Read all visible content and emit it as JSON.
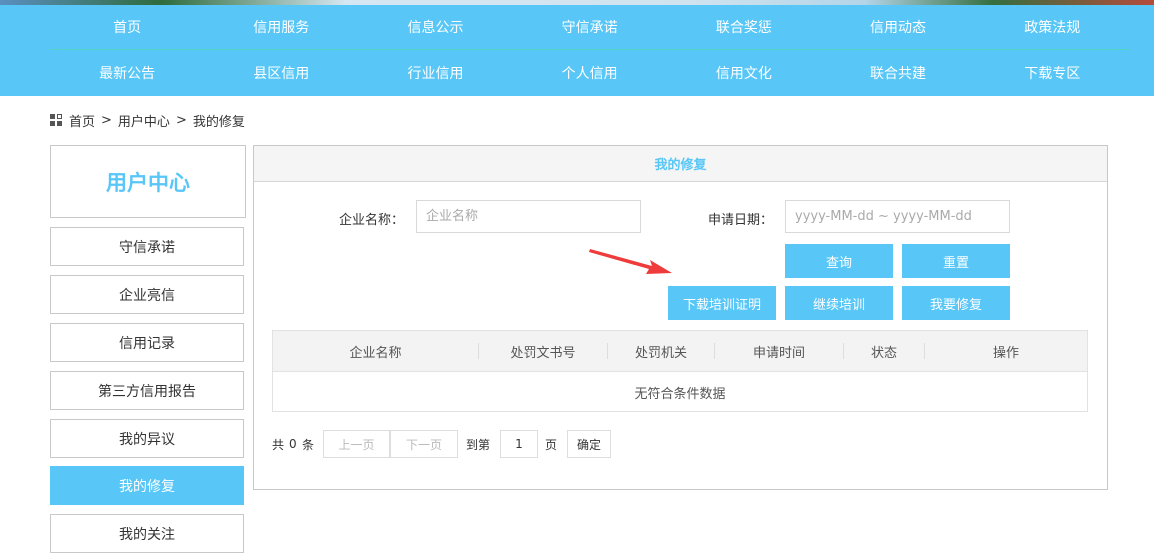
{
  "nav": {
    "row1": [
      "首页",
      "信用服务",
      "信息公示",
      "守信承诺",
      "联合奖惩",
      "信用动态",
      "政策法规"
    ],
    "row2": [
      "最新公告",
      "县区信用",
      "行业信用",
      "个人信用",
      "信用文化",
      "联合共建",
      "下载专区"
    ]
  },
  "breadcrumb": {
    "home": "首页",
    "sep": ">",
    "level1": "用户中心",
    "current": "我的修复"
  },
  "sidebar": {
    "title": "用户中心",
    "items": [
      "守信承诺",
      "企业亮信",
      "信用记录",
      "第三方信用报告",
      "我的异议",
      "我的修复",
      "我的关注"
    ],
    "active_index": 5
  },
  "panel": {
    "title": "我的修复",
    "form": {
      "company_label": "企业名称：",
      "company_placeholder": "企业名称",
      "date_label": "申请日期：",
      "date_placeholder": "yyyy-MM-dd ~ yyyy-MM-dd"
    },
    "buttons": {
      "query": "查询",
      "reset": "重置",
      "download_cert": "下载培训证明",
      "continue_training": "继续培训",
      "apply_repair": "我要修复"
    },
    "table": {
      "columns": [
        "企业名称",
        "处罚文书号",
        "处罚机关",
        "申请时间",
        "状态",
        "操作"
      ],
      "empty_text": "无符合条件数据"
    },
    "pager": {
      "total_prefix": "共",
      "total_count": "0",
      "total_suffix": "条",
      "prev": "上一页",
      "next": "下一页",
      "goto_prefix": "到第",
      "page_value": "1",
      "goto_suffix": "页",
      "confirm": "确定"
    }
  },
  "colors": {
    "accent": "#58c7f8",
    "annotation_arrow": "#ee3b3b"
  }
}
